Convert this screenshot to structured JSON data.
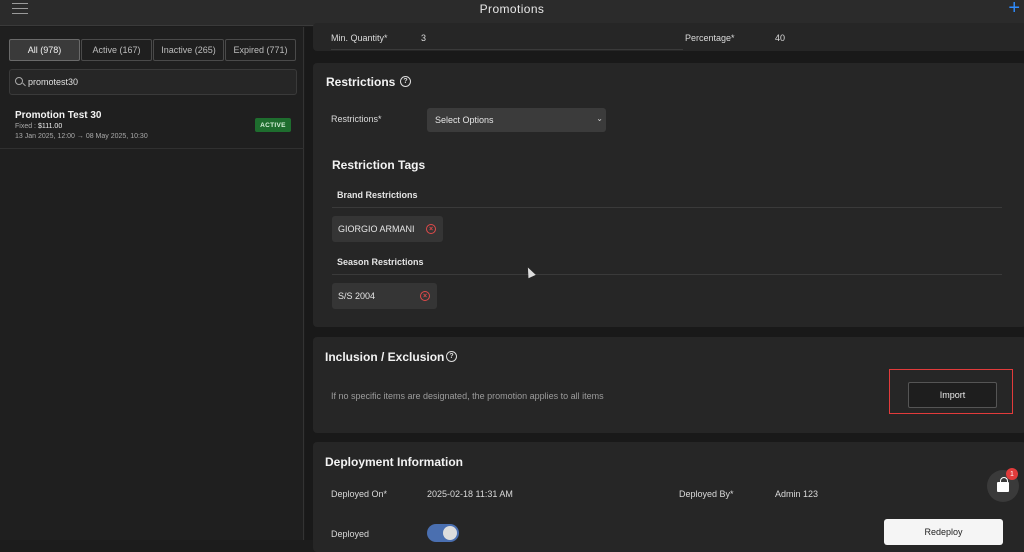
{
  "app": {
    "title": "Promotions"
  },
  "tabs": [
    {
      "label": "All (978)"
    },
    {
      "label": "Active (167)"
    },
    {
      "label": "Inactive (265)"
    },
    {
      "label": "Expired (771)"
    }
  ],
  "search": {
    "value": "promotest30"
  },
  "promotion": {
    "name": "Promotion Test 30",
    "type_label": "Fixed : ",
    "amount": "$111.00",
    "dates": "13 Jan 2025, 12:00 → 08 May 2025, 10:30",
    "status": "ACTIVE"
  },
  "top_row": {
    "min_qty_label": "Min. Quantity*",
    "min_qty_value": "3",
    "percentage_label": "Percentage*",
    "percentage_value": "40"
  },
  "restrictions": {
    "heading": "Restrictions",
    "field_label": "Restrictions*",
    "select_value": "Select Options",
    "tags_heading": "Restriction Tags",
    "brand_heading": "Brand Restrictions",
    "brand_tag": "GIORGIO ARMANI",
    "season_heading": "Season Restrictions",
    "season_tag": "S/S 2004"
  },
  "inclusion": {
    "heading": "Inclusion / Exclusion",
    "note": "If no specific items are designated, the promotion applies to all items",
    "import_label": "Import"
  },
  "deployment": {
    "heading": "Deployment Information",
    "deployed_on_label": "Deployed On*",
    "deployed_on_value": "2025-02-18 11:31 AM",
    "deployed_by_label": "Deployed By*",
    "deployed_by_value": "Admin 123",
    "deployed_label": "Deployed",
    "redeploy_label": "Redeploy"
  },
  "cart": {
    "count": "1"
  },
  "colors": {
    "accent": "#2f8cff",
    "active_badge": "#1e6d2e",
    "highlight": "#e23b3b"
  }
}
